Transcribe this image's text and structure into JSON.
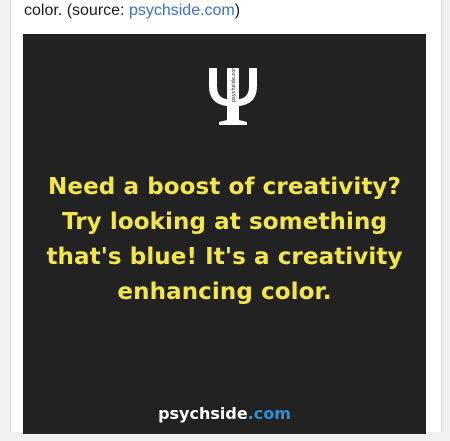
{
  "caption": {
    "prefix": "color. (source: ",
    "link_text": "psychside.com",
    "suffix": ")"
  },
  "poster": {
    "logo_text": "psychside.com",
    "lines": [
      "Need a boost of creativity?",
      "Try looking at something",
      "that's blue! It's a creativity",
      "enhancing color."
    ],
    "footer_name": "psychside",
    "footer_tld": ".com",
    "colors": {
      "background": "#222222",
      "text": "#f3e64a",
      "accent": "#2f8fd6"
    }
  }
}
